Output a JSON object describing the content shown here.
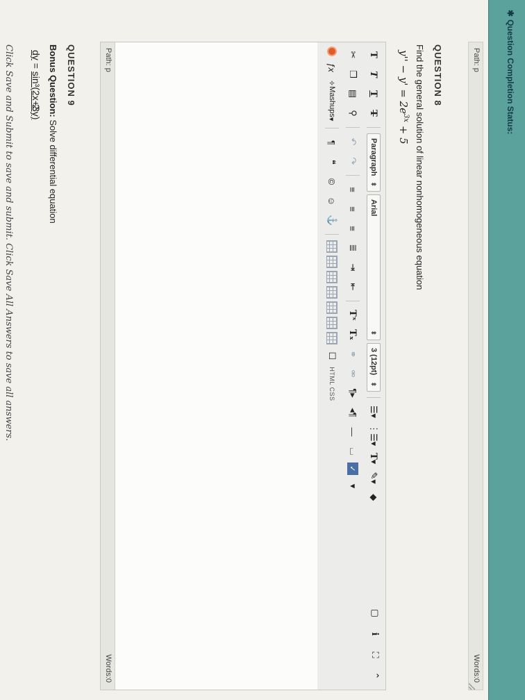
{
  "status": {
    "label": "Question Completion Status:"
  },
  "prev_editor": {
    "path": "Path: p",
    "words": "Words:0"
  },
  "q8": {
    "title": "QUESTION 8",
    "text": "Find the general solution of linear nonhomogeneous equation",
    "eq_main": "y'' − y' = 2e",
    "eq_sup": "3x",
    "eq_tail": " + 5"
  },
  "toolbar": {
    "btn_bold": "T",
    "btn_italic": "T",
    "btn_underline": "T",
    "btn_strike": "T",
    "paragraph": "Paragraph",
    "font": "Arial",
    "size": "3 (12pt)",
    "mashups": "Mashups",
    "html_css": "HTML CSS"
  },
  "editor": {
    "path": "Path: p",
    "words": "Words:0"
  },
  "q9": {
    "title": "QUESTION 9",
    "text_bold": "Bonus Question:",
    "text": " Solve differential equation",
    "dy": "dy",
    "equals": "=",
    "rhs": "sin³(2x+3y)",
    "rhs2": "2",
    "note": "Click Save and Submit to save and submit. Click Save All Answers to save all answers."
  },
  "colors": {
    "status_bar": "#5aa29b",
    "accent": "#4a6fa5"
  }
}
